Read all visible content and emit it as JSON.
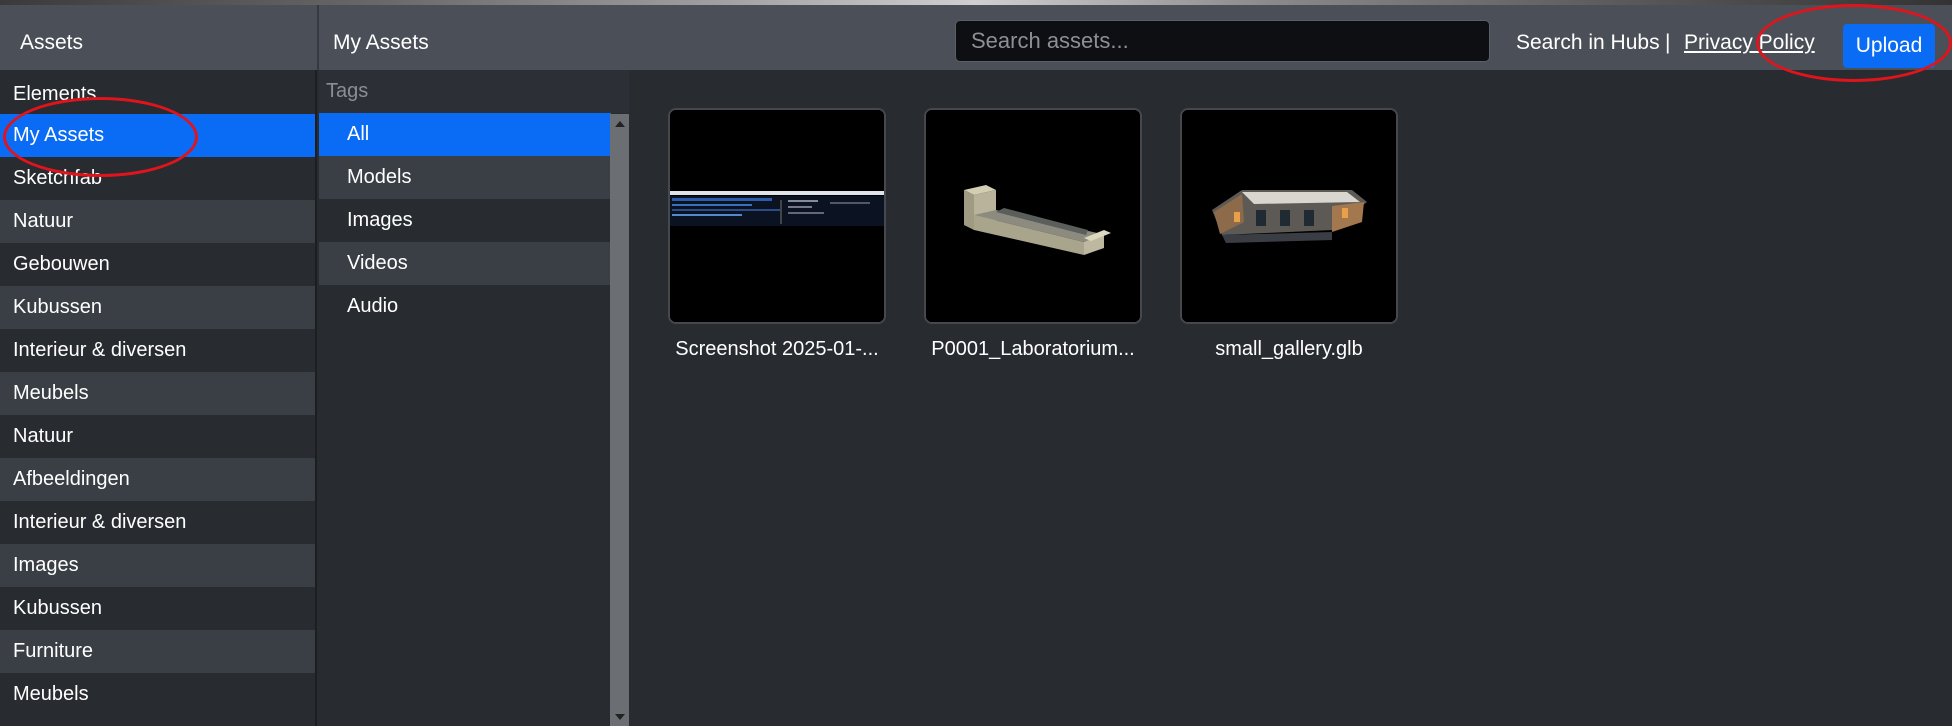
{
  "header": {
    "assets_label": "Assets",
    "section_title": "My Assets",
    "search_placeholder": "Search assets...",
    "search_in_hubs": "Search in Hubs",
    "separator": "|",
    "privacy_policy": "Privacy Policy",
    "upload_label": "Upload"
  },
  "sidebar": {
    "items": [
      {
        "label": "Elements"
      },
      {
        "label": "My Assets"
      },
      {
        "label": "Sketchfab"
      },
      {
        "label": "Natuur"
      },
      {
        "label": "Gebouwen"
      },
      {
        "label": "Kubussen"
      },
      {
        "label": "Interieur & diversen"
      },
      {
        "label": "Meubels"
      },
      {
        "label": "Natuur"
      },
      {
        "label": "Afbeeldingen"
      },
      {
        "label": "Interieur & diversen"
      },
      {
        "label": "Images"
      },
      {
        "label": "Kubussen"
      },
      {
        "label": "Furniture"
      },
      {
        "label": "Meubels"
      }
    ],
    "active": "My Assets"
  },
  "tags": {
    "heading": "Tags",
    "items": [
      {
        "label": "All"
      },
      {
        "label": "Models"
      },
      {
        "label": "Images"
      },
      {
        "label": "Videos"
      },
      {
        "label": "Audio"
      }
    ],
    "active": "All"
  },
  "assets": [
    {
      "name": "Screenshot 2025-01-...",
      "icon": "screenshot-thumbnail"
    },
    {
      "name": "P0001_Laboratorium...",
      "icon": "building-model-thumbnail"
    },
    {
      "name": "small_gallery.glb",
      "icon": "gallery-model-thumbnail"
    }
  ],
  "colors": {
    "accent": "#0a6cf5",
    "annotation": "#e0141c",
    "header_bg": "#4b5058",
    "panel_bg": "#282b30"
  }
}
